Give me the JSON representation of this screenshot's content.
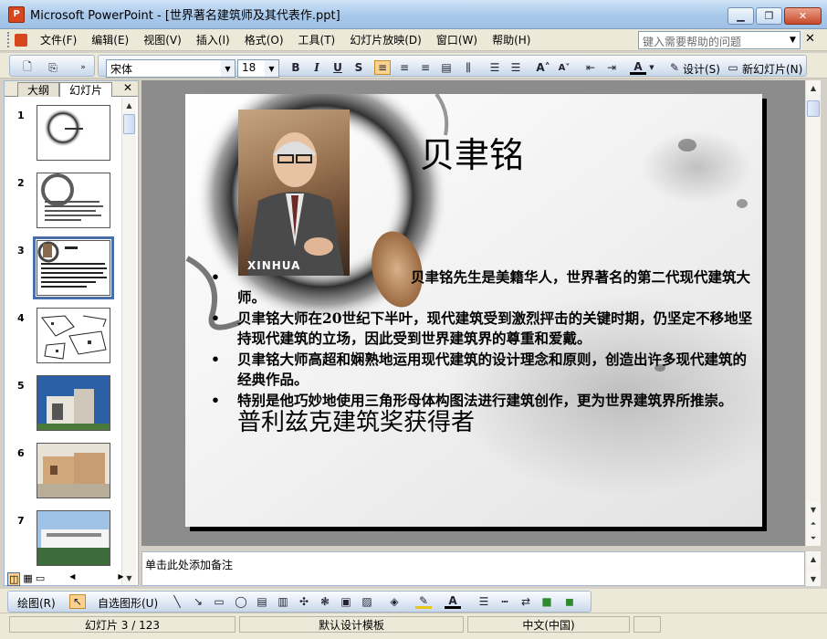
{
  "window": {
    "title": "Microsoft PowerPoint - [世界著名建筑师及其代表作.ppt]",
    "app_icon_text": "P"
  },
  "menu": {
    "items": [
      "文件(F)",
      "编辑(E)",
      "视图(V)",
      "插入(I)",
      "格式(O)",
      "工具(T)",
      "幻灯片放映(D)",
      "窗口(W)",
      "帮助(H)"
    ],
    "help_placeholder": "键入需要帮助的问题"
  },
  "toolbar": {
    "font_name": "宋体",
    "font_size": "18",
    "bold": "B",
    "italic": "I",
    "underline": "U",
    "shadow": "S",
    "design_label": "设计(S)",
    "new_slide_label": "新幻灯片(N)"
  },
  "pane": {
    "tabs": [
      "大纲",
      "幻灯片"
    ],
    "active_tab": "幻灯片",
    "thumbnails": [
      {
        "num": "1"
      },
      {
        "num": "2"
      },
      {
        "num": "3"
      },
      {
        "num": "4"
      },
      {
        "num": "5"
      },
      {
        "num": "6"
      },
      {
        "num": "7"
      }
    ],
    "selected": "3"
  },
  "slide": {
    "title": "贝聿铭",
    "photo_caption": "XINHUA",
    "bullets": [
      "贝聿铭先生是美籍华人，世界著名的第二代现代建筑大师。",
      "贝聿铭大师在20世纪下半叶，现代建筑受到激烈抨击的关键时期，仍坚定不移地坚持现代建筑的立场，因此受到世界建筑界的尊重和爱戴。",
      "贝聿铭大师高超和娴熟地运用现代建筑的设计理念和原则，创造出许多现代建筑的经典作品。",
      "特别是他巧妙地使用三角形母体构图法进行建筑创作，更为世界建筑界所推崇。"
    ],
    "bullet_tail": "普利兹克建筑奖获得者",
    "bullet_char": "•"
  },
  "notes": {
    "placeholder": "单击此处添加备注"
  },
  "drawing": {
    "draw_label": "绘图(R)",
    "autoshapes_label": "自选图形(U)"
  },
  "status": {
    "slide_position": "幻灯片 3 / 123",
    "template": "默认设计模板",
    "language": "中文(中国)"
  },
  "colors": {
    "accent": "#4a6ea9",
    "title_bar": "#a8c8ea",
    "workspace": "#8c8c8c"
  }
}
